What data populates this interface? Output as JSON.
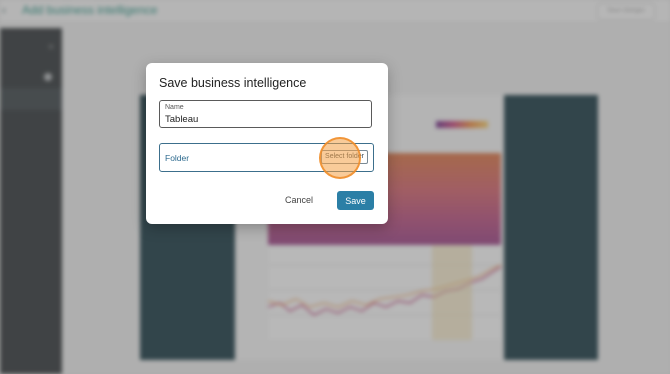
{
  "app": {
    "back_glyph": "‹",
    "page_title": "Add business intelligence",
    "top_button_label": "Save changes"
  },
  "sidebar": {
    "close_glyph": "×"
  },
  "modal": {
    "title": "Save business intelligence",
    "name_field": {
      "label": "Name",
      "value": "Tableau"
    },
    "folder_field": {
      "label": "Folder",
      "button_label": "Select folder"
    },
    "cancel_label": "Cancel",
    "save_label": "Save"
  },
  "colors": {
    "accent": "#2b7fa6",
    "title_teal": "#1e8f7f",
    "dark_panel": "#153640",
    "click_indicator": "#f4a046"
  }
}
